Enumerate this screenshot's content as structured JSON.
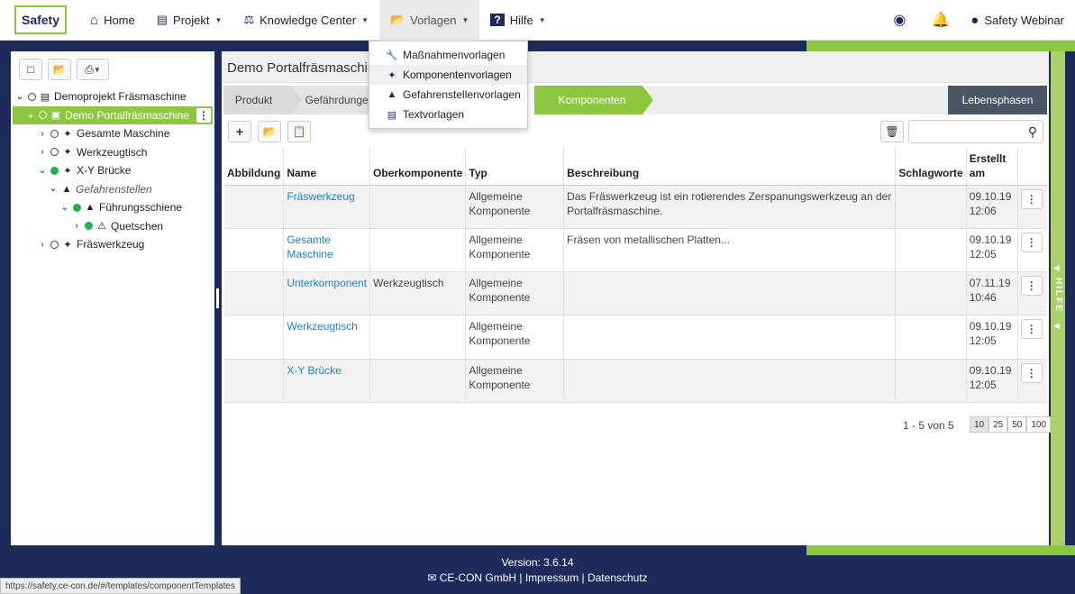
{
  "navbar": {
    "logo": "Safety",
    "items": [
      {
        "label": "Home",
        "icon": "home-icon"
      },
      {
        "label": "Projekt",
        "icon": "project-icon"
      },
      {
        "label": "Knowledge Center",
        "icon": "scales-icon"
      },
      {
        "label": "Vorlagen",
        "icon": "folder-open-icon"
      },
      {
        "label": "Hilfe",
        "icon": "help-icon"
      }
    ],
    "user": "Safety Webinar"
  },
  "dropdown": {
    "items": [
      {
        "label": "Maßnahmenvorlagen",
        "icon": "wrench-icon"
      },
      {
        "label": "Komponentenvorlagen",
        "icon": "puzzle-icon"
      },
      {
        "label": "Gefahrenstellenvorlagen",
        "icon": "hazard-icon"
      },
      {
        "label": "Textvorlagen",
        "icon": "text-doc-icon"
      }
    ]
  },
  "tree": {
    "nodes": [
      {
        "label": "Demoprojekt Fräsmaschine"
      },
      {
        "label": "Demo Portalfräsmaschine"
      },
      {
        "label": "Gesamte Maschine"
      },
      {
        "label": "Werkzeugtisch"
      },
      {
        "label": "X-Y Brücke"
      },
      {
        "label": "Gefahrenstellen"
      },
      {
        "label": "Führungsschiene"
      },
      {
        "label": "Quetschen"
      },
      {
        "label": "Fräswerkzeug"
      }
    ]
  },
  "main": {
    "title": "Demo Portalfräsmaschine",
    "steps": {
      "s1": "Produkt",
      "s2": "Gefährdungen",
      "s3": "Komponenten"
    },
    "phase_button": "Lebensphasen",
    "columns": [
      "Abbildung",
      "Name",
      "Oberkomponente",
      "Typ",
      "Beschreibung",
      "Schlagworte",
      "Erstellt am"
    ],
    "rows": [
      {
        "name": "Fräswerkzeug",
        "parent": "",
        "type": "Allgemeine Komponente",
        "description": "Das Fräswerkzeug ist ein rotierendes Zerspanungswerkzeug an der Portalfräsmaschine.",
        "tags": "",
        "created": "09.10.19 12:06"
      },
      {
        "name": "Gesamte Maschine",
        "parent": "",
        "type": "Allgemeine Komponente",
        "description": "Fräsen von metallischen Platten...",
        "tags": "",
        "created": "09.10.19 12:05"
      },
      {
        "name": "Unterkomponent",
        "parent": "Werkzeugtisch",
        "type": "Allgemeine Komponente",
        "description": "",
        "tags": "",
        "created": "07.11.19 10:46"
      },
      {
        "name": "Werkzeugtisch",
        "parent": "",
        "type": "Allgemeine Komponente",
        "description": "",
        "tags": "",
        "created": "09.10.19 12:05"
      },
      {
        "name": "X-Y Brücke",
        "parent": "",
        "type": "Allgemeine Komponente",
        "description": "",
        "tags": "",
        "created": "09.10.19 12:05"
      }
    ],
    "pager": {
      "info": "1 - 5 von 5",
      "sizes": [
        "10",
        "25",
        "50",
        "100"
      ]
    }
  },
  "help_tab": "HILFE",
  "footer": {
    "version": "Version: 3.6.14",
    "links": "CE-CON GmbH | Impressum | Datenschutz"
  },
  "statusbar": "https://safety.ce-con.de/#/templates/componentTemplates",
  "colors": {
    "accent": "#8dc63f",
    "navy": "#1d2a5a",
    "link": "#1d7fbf"
  }
}
